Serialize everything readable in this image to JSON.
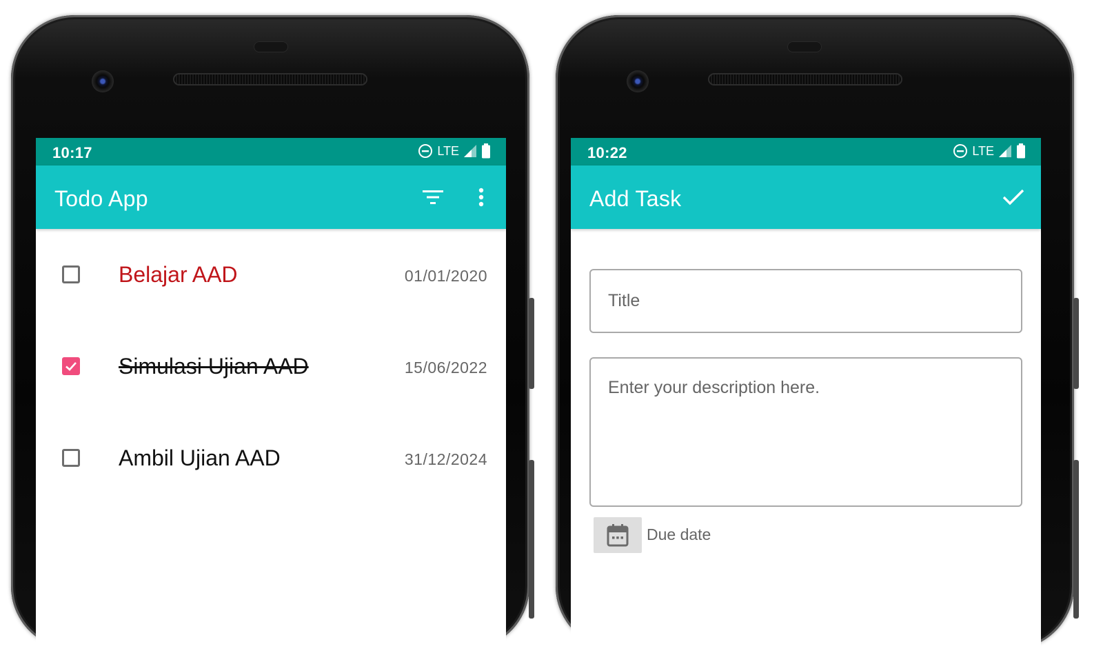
{
  "left_phone": {
    "status": {
      "time": "10:17",
      "network": "LTE"
    },
    "app_bar": {
      "title": "Todo App",
      "filter_icon": "filter-list-icon",
      "more_icon": "more-vert-icon"
    },
    "tasks": [
      {
        "title": "Belajar AAD",
        "date": "01/01/2020",
        "checked": false,
        "title_color": "#C0151A"
      },
      {
        "title": "Simulasi Ujian AAD",
        "date": "15/06/2022",
        "checked": true,
        "title_color": "#111111"
      },
      {
        "title": "Ambil Ujian AAD",
        "date": "31/12/2024",
        "checked": false,
        "title_color": "#111111"
      }
    ]
  },
  "right_phone": {
    "status": {
      "time": "10:22",
      "network": "LTE"
    },
    "app_bar": {
      "title": "Add Task",
      "save_icon": "check-icon"
    },
    "form": {
      "title_placeholder": "Title",
      "description_placeholder": "Enter your description here.",
      "due_date_label": "Due date",
      "due_date_icon": "calendar-icon"
    }
  },
  "colors": {
    "status_bar": "#009688",
    "app_bar": "#13C4C4",
    "checkbox_checked": "#F04C7D",
    "overdue_title": "#C0151A"
  }
}
